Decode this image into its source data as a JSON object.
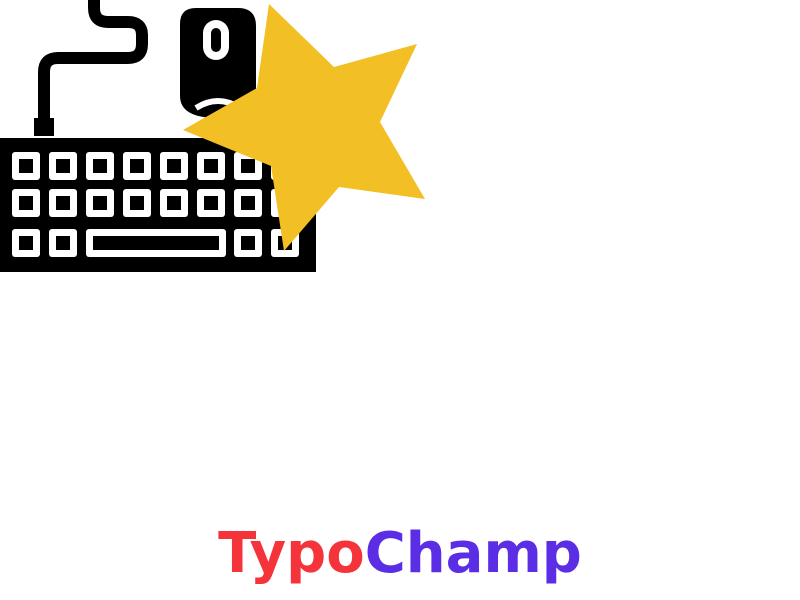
{
  "logo": {
    "icons": [
      "keyboard-icon",
      "mouse-icon",
      "cable-icon",
      "star-icon"
    ],
    "colors": {
      "icon": "#000000",
      "keys": "#ffffff",
      "star": "#f2bf24"
    }
  },
  "wordmark": {
    "part1": "Typo",
    "part2": "Champ",
    "colors": {
      "part1": "#f4333a",
      "part2": "#5b2ee6"
    }
  }
}
